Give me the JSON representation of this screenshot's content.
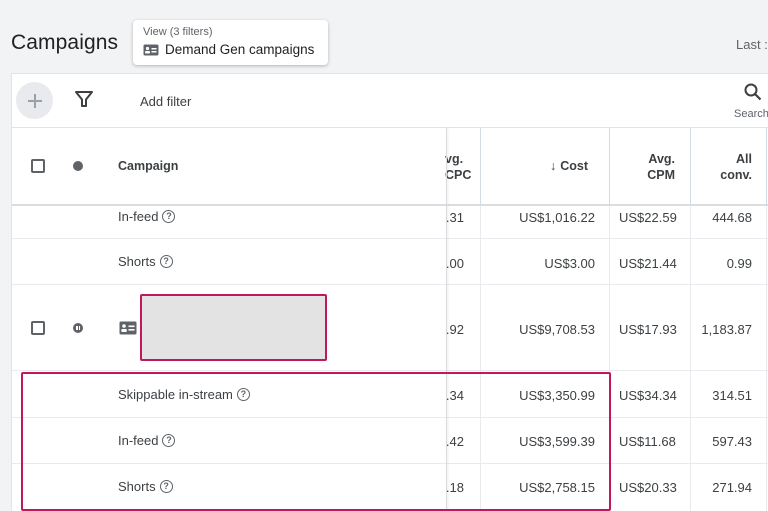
{
  "header": {
    "title": "Campaigns",
    "view_caption": "View (3 filters)",
    "view_value": "Demand Gen campaigns",
    "date_range_partial": "Last :"
  },
  "toolbar": {
    "add_filter": "Add filter",
    "search_label": "Search"
  },
  "table": {
    "columns": {
      "campaign": "Campaign",
      "avg_cpc_partial_1": "vg.",
      "avg_cpc_partial_2": "CPC",
      "cost_arrow": "↓",
      "cost": "Cost",
      "avg_cpm_1": "Avg.",
      "avg_cpm_2": "CPM",
      "all_conv_1": "All",
      "all_conv_2": "conv."
    },
    "rows": [
      {
        "name": "In-feed",
        "cpc": ".31",
        "cost": "US$1,016.22",
        "cpm": "US$22.59",
        "conv": "444.68"
      },
      {
        "name": "Shorts",
        "cpc": ".00",
        "cost": "US$3.00",
        "cpm": "US$21.44",
        "conv": "0.99"
      },
      {
        "name": "",
        "cpc": ".92",
        "cost": "US$9,708.53",
        "cpm": "US$17.93",
        "conv": "1,183.87"
      },
      {
        "name": "Skippable in-stream",
        "cpc": ".34",
        "cost": "US$3,350.99",
        "cpm": "US$34.34",
        "conv": "314.51"
      },
      {
        "name": "In-feed",
        "cpc": ".42",
        "cost": "US$3,599.39",
        "cpm": "US$11.68",
        "conv": "597.43"
      },
      {
        "name": "Shorts",
        "cpc": ".18",
        "cost": "US$2,758.15",
        "cpm": "US$20.33",
        "conv": "271.94"
      }
    ]
  },
  "help_glyph": "?",
  "colors": {
    "highlight": "#c2185b",
    "redaction": "#e3e3e3"
  }
}
